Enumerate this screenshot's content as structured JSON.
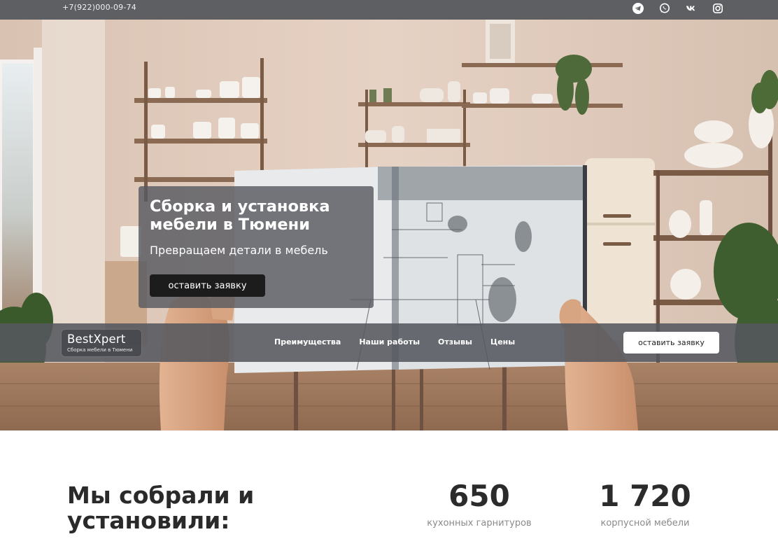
{
  "topbar": {
    "phone": "+7(922)000-09-74",
    "socials": [
      {
        "name": "telegram-icon"
      },
      {
        "name": "whatsapp-icon"
      },
      {
        "name": "vk-icon"
      },
      {
        "name": "instagram-icon"
      }
    ]
  },
  "hero": {
    "title": "Сборка и установка мебели в Тюмени",
    "subtitle": "Превращаем детали в мебель",
    "cta": "оставить заявку"
  },
  "nav": {
    "logo_name": "BestXpert",
    "logo_tagline": "Сборка мебели в Тюмени",
    "items": [
      {
        "label": "Преимущества"
      },
      {
        "label": "Наши работы"
      },
      {
        "label": "Отзывы"
      },
      {
        "label": "Цены"
      }
    ],
    "cta": "оставить заявку"
  },
  "stats": {
    "heading": "Мы собрали и установили:",
    "items": [
      {
        "number": "650",
        "label": "кухонных гарнитуров"
      },
      {
        "number": "1 720",
        "label": "корпусной мебели"
      }
    ]
  },
  "colors": {
    "topbar_bg": "#5d5f63",
    "overlay_bg": "#585a60",
    "cta_dark": "#1c1c1c",
    "text_dark": "#2a2a2a",
    "muted": "#8a8a8a"
  }
}
